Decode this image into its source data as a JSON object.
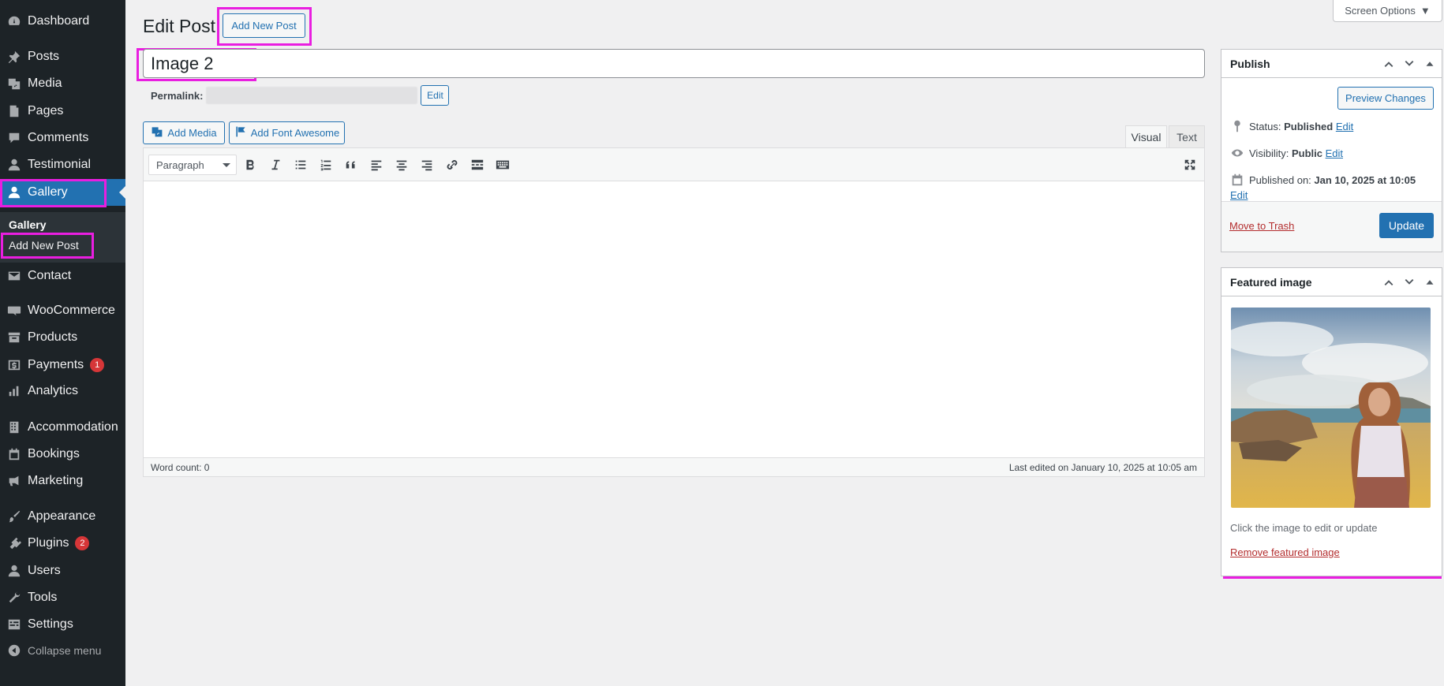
{
  "sidebar": {
    "items": [
      {
        "label": "Dashboard",
        "icon": "dashboard-icon"
      },
      {
        "label": "Posts",
        "icon": "pin-icon"
      },
      {
        "label": "Media",
        "icon": "media-icon"
      },
      {
        "label": "Pages",
        "icon": "pages-icon"
      },
      {
        "label": "Comments",
        "icon": "comment-icon"
      },
      {
        "label": "Testimonial",
        "icon": "user-icon"
      },
      {
        "label": "Gallery",
        "icon": "user-icon"
      },
      {
        "label": "Contact",
        "icon": "mail-icon"
      },
      {
        "label": "WooCommerce",
        "icon": "woo-icon"
      },
      {
        "label": "Products",
        "icon": "archive-icon"
      },
      {
        "label": "Payments",
        "icon": "dollar-icon",
        "badge": "1"
      },
      {
        "label": "Analytics",
        "icon": "bar-chart-icon"
      },
      {
        "label": "Accommodation",
        "icon": "building-icon"
      },
      {
        "label": "Bookings",
        "icon": "calendar-icon"
      },
      {
        "label": "Marketing",
        "icon": "megaphone-icon"
      },
      {
        "label": "Appearance",
        "icon": "brush-icon"
      },
      {
        "label": "Plugins",
        "icon": "plugin-icon",
        "badge": "2"
      },
      {
        "label": "Users",
        "icon": "user-icon"
      },
      {
        "label": "Tools",
        "icon": "wrench-icon"
      },
      {
        "label": "Settings",
        "icon": "settings-icon"
      }
    ],
    "submenu": {
      "title": "Gallery",
      "add_new": "Add New Post"
    },
    "collapse_label": "Collapse menu"
  },
  "header": {
    "title": "Edit Post",
    "add_new_label": "Add New Post",
    "screen_options_label": "Screen Options"
  },
  "post": {
    "title": "Image 2",
    "permalink_label": "Permalink:",
    "permalink_edit": "Edit"
  },
  "editor": {
    "add_media_label": "Add Media",
    "add_font_awesome_label": "Add Font Awesome",
    "tab_visual": "Visual",
    "tab_text": "Text",
    "format_value": "Paragraph",
    "word_count": "Word count: 0",
    "last_edited": "Last edited on January 10, 2025 at 10:05 am"
  },
  "publish_box": {
    "title": "Publish",
    "preview_label": "Preview Changes",
    "status_label": "Status:",
    "status_value": "Published",
    "visibility_label": "Visibility:",
    "visibility_value": "Public",
    "published_on_label": "Published on:",
    "published_on_value": "Jan 10, 2025 at 10:05",
    "edit_label": "Edit",
    "trash_label": "Move to Trash",
    "update_label": "Update"
  },
  "featured_box": {
    "title": "Featured image",
    "help_text": "Click the image to edit or update",
    "remove_label": "Remove featured image"
  },
  "colors": {
    "sidebar_bg": "#1d2327",
    "accent": "#2271b1",
    "highlight": "#e91ee0",
    "danger": "#b32d2e"
  }
}
